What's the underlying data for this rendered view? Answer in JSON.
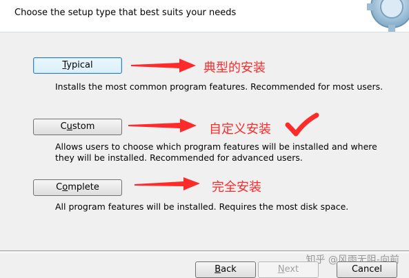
{
  "header": {
    "instruction": "Choose the setup type that best suits your needs"
  },
  "options": [
    {
      "label_pre": "",
      "label_key": "T",
      "label_post": "ypical",
      "description": "Installs the most common program features. Recommended for most users.",
      "annotation": "典型的安装"
    },
    {
      "label_pre": "C",
      "label_key": "u",
      "label_post": "stom",
      "description_line1": "Allows users to choose which program features will be installed and where",
      "description_line2": "they will be installed. Recommended for advanced users.",
      "annotation": "自定义安装"
    },
    {
      "label_pre": "C",
      "label_key": "o",
      "label_post": "mplete",
      "description": "All program features will be installed. Requires the most disk space.",
      "annotation": "完全安装"
    }
  ],
  "nav": {
    "back_key": "B",
    "back_post": "ack",
    "next_key": "N",
    "next_post": "ext",
    "cancel": "Cancel"
  },
  "watermark": "知乎 @风雨无阻-向前",
  "colors": {
    "annotation": "#ff2a2a",
    "header_bg": "#ffffff",
    "panel_bg": "#f0f0f0"
  },
  "icons": [
    "gear-icon",
    "arrow-right-icon",
    "checkmark-icon"
  ]
}
